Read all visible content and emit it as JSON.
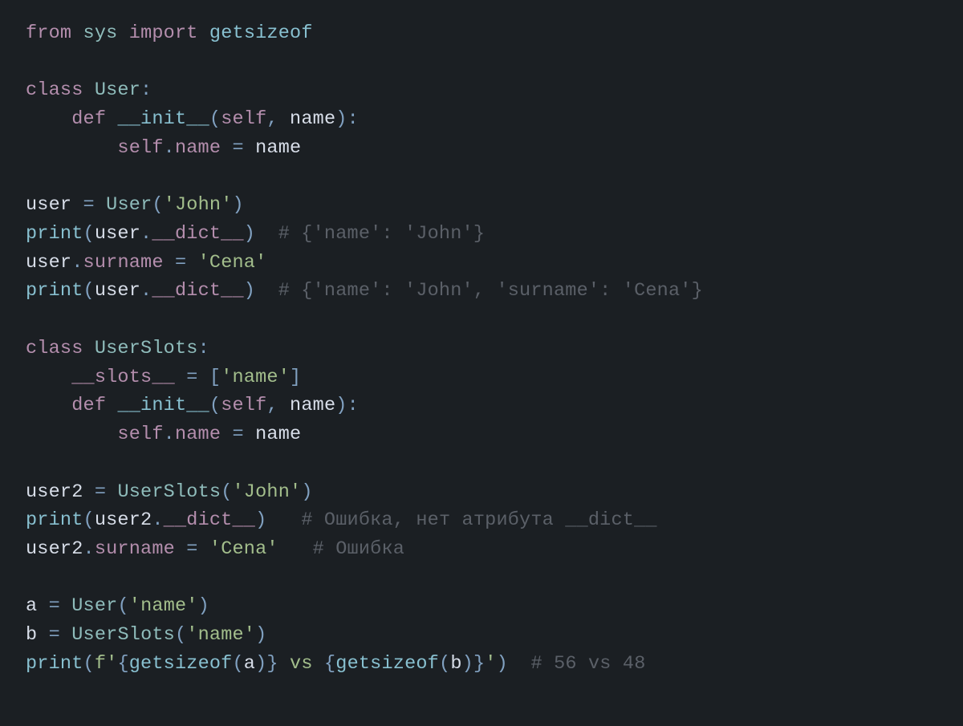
{
  "lines": [
    [
      {
        "cls": "kw",
        "t": "from"
      },
      {
        "cls": "",
        "t": " "
      },
      {
        "cls": "mod",
        "t": "sys"
      },
      {
        "cls": "",
        "t": " "
      },
      {
        "cls": "kw",
        "t": "import"
      },
      {
        "cls": "",
        "t": " "
      },
      {
        "cls": "fn",
        "t": "getsizeof"
      }
    ],
    [],
    [
      {
        "cls": "kw",
        "t": "class"
      },
      {
        "cls": "",
        "t": " "
      },
      {
        "cls": "cls",
        "t": "User"
      },
      {
        "cls": "op",
        "t": ":"
      }
    ],
    [
      {
        "cls": "",
        "t": "    "
      },
      {
        "cls": "kw",
        "t": "def"
      },
      {
        "cls": "",
        "t": " "
      },
      {
        "cls": "dunder",
        "t": "__init__"
      },
      {
        "cls": "op",
        "t": "("
      },
      {
        "cls": "slf",
        "t": "self"
      },
      {
        "cls": "op",
        "t": ","
      },
      {
        "cls": "",
        "t": " "
      },
      {
        "cls": "var",
        "t": "name"
      },
      {
        "cls": "op",
        "t": ")"
      },
      {
        "cls": "op",
        "t": ":"
      }
    ],
    [
      {
        "cls": "",
        "t": "        "
      },
      {
        "cls": "slf",
        "t": "self"
      },
      {
        "cls": "op",
        "t": "."
      },
      {
        "cls": "attr",
        "t": "name"
      },
      {
        "cls": "",
        "t": " "
      },
      {
        "cls": "op",
        "t": "="
      },
      {
        "cls": "",
        "t": " "
      },
      {
        "cls": "var",
        "t": "name"
      }
    ],
    [],
    [
      {
        "cls": "var",
        "t": "user"
      },
      {
        "cls": "",
        "t": " "
      },
      {
        "cls": "op",
        "t": "="
      },
      {
        "cls": "",
        "t": " "
      },
      {
        "cls": "cls",
        "t": "User"
      },
      {
        "cls": "op",
        "t": "("
      },
      {
        "cls": "str",
        "t": "'John'"
      },
      {
        "cls": "op",
        "t": ")"
      }
    ],
    [
      {
        "cls": "fn",
        "t": "print"
      },
      {
        "cls": "op",
        "t": "("
      },
      {
        "cls": "var",
        "t": "user"
      },
      {
        "cls": "op",
        "t": "."
      },
      {
        "cls": "dct",
        "t": "__dict__"
      },
      {
        "cls": "op",
        "t": ")"
      },
      {
        "cls": "",
        "t": "  "
      },
      {
        "cls": "cmt",
        "t": "# {'name': 'John'}"
      }
    ],
    [
      {
        "cls": "var",
        "t": "user"
      },
      {
        "cls": "op",
        "t": "."
      },
      {
        "cls": "attr",
        "t": "surname"
      },
      {
        "cls": "",
        "t": " "
      },
      {
        "cls": "op",
        "t": "="
      },
      {
        "cls": "",
        "t": " "
      },
      {
        "cls": "str",
        "t": "'Cena'"
      }
    ],
    [
      {
        "cls": "fn",
        "t": "print"
      },
      {
        "cls": "op",
        "t": "("
      },
      {
        "cls": "var",
        "t": "user"
      },
      {
        "cls": "op",
        "t": "."
      },
      {
        "cls": "dct",
        "t": "__dict__"
      },
      {
        "cls": "op",
        "t": ")"
      },
      {
        "cls": "",
        "t": "  "
      },
      {
        "cls": "cmt",
        "t": "# {'name': 'John', 'surname': 'Cena'}"
      }
    ],
    [],
    [
      {
        "cls": "kw",
        "t": "class"
      },
      {
        "cls": "",
        "t": " "
      },
      {
        "cls": "cls",
        "t": "UserSlots"
      },
      {
        "cls": "op",
        "t": ":"
      }
    ],
    [
      {
        "cls": "",
        "t": "    "
      },
      {
        "cls": "dct",
        "t": "__slots__"
      },
      {
        "cls": "",
        "t": " "
      },
      {
        "cls": "op",
        "t": "="
      },
      {
        "cls": "",
        "t": " "
      },
      {
        "cls": "op",
        "t": "["
      },
      {
        "cls": "str",
        "t": "'name'"
      },
      {
        "cls": "op",
        "t": "]"
      }
    ],
    [
      {
        "cls": "",
        "t": "    "
      },
      {
        "cls": "kw",
        "t": "def"
      },
      {
        "cls": "",
        "t": " "
      },
      {
        "cls": "dunder",
        "t": "__init__"
      },
      {
        "cls": "op",
        "t": "("
      },
      {
        "cls": "slf",
        "t": "self"
      },
      {
        "cls": "op",
        "t": ","
      },
      {
        "cls": "",
        "t": " "
      },
      {
        "cls": "var",
        "t": "name"
      },
      {
        "cls": "op",
        "t": ")"
      },
      {
        "cls": "op",
        "t": ":"
      }
    ],
    [
      {
        "cls": "",
        "t": "        "
      },
      {
        "cls": "slf",
        "t": "self"
      },
      {
        "cls": "op",
        "t": "."
      },
      {
        "cls": "attr",
        "t": "name"
      },
      {
        "cls": "",
        "t": " "
      },
      {
        "cls": "op",
        "t": "="
      },
      {
        "cls": "",
        "t": " "
      },
      {
        "cls": "var",
        "t": "name"
      }
    ],
    [],
    [
      {
        "cls": "var",
        "t": "user2"
      },
      {
        "cls": "",
        "t": " "
      },
      {
        "cls": "op",
        "t": "="
      },
      {
        "cls": "",
        "t": " "
      },
      {
        "cls": "cls",
        "t": "UserSlots"
      },
      {
        "cls": "op",
        "t": "("
      },
      {
        "cls": "str",
        "t": "'John'"
      },
      {
        "cls": "op",
        "t": ")"
      }
    ],
    [
      {
        "cls": "fn",
        "t": "print"
      },
      {
        "cls": "op",
        "t": "("
      },
      {
        "cls": "var",
        "t": "user2"
      },
      {
        "cls": "op",
        "t": "."
      },
      {
        "cls": "dct",
        "t": "__dict__"
      },
      {
        "cls": "op",
        "t": ")"
      },
      {
        "cls": "",
        "t": "   "
      },
      {
        "cls": "cmt",
        "t": "# Ошибка, нет атрибута __dict__"
      }
    ],
    [
      {
        "cls": "var",
        "t": "user2"
      },
      {
        "cls": "op",
        "t": "."
      },
      {
        "cls": "attr",
        "t": "surname"
      },
      {
        "cls": "",
        "t": " "
      },
      {
        "cls": "op",
        "t": "="
      },
      {
        "cls": "",
        "t": " "
      },
      {
        "cls": "str",
        "t": "'Cena'"
      },
      {
        "cls": "",
        "t": "   "
      },
      {
        "cls": "cmt",
        "t": "# Ошибка"
      }
    ],
    [],
    [
      {
        "cls": "var",
        "t": "a"
      },
      {
        "cls": "",
        "t": " "
      },
      {
        "cls": "op",
        "t": "="
      },
      {
        "cls": "",
        "t": " "
      },
      {
        "cls": "cls",
        "t": "User"
      },
      {
        "cls": "op",
        "t": "("
      },
      {
        "cls": "str",
        "t": "'name'"
      },
      {
        "cls": "op",
        "t": ")"
      }
    ],
    [
      {
        "cls": "var",
        "t": "b"
      },
      {
        "cls": "",
        "t": " "
      },
      {
        "cls": "op",
        "t": "="
      },
      {
        "cls": "",
        "t": " "
      },
      {
        "cls": "cls",
        "t": "UserSlots"
      },
      {
        "cls": "op",
        "t": "("
      },
      {
        "cls": "str",
        "t": "'name'"
      },
      {
        "cls": "op",
        "t": ")"
      }
    ],
    [
      {
        "cls": "fn",
        "t": "print"
      },
      {
        "cls": "op",
        "t": "("
      },
      {
        "cls": "str",
        "t": "f'"
      },
      {
        "cls": "op",
        "t": "{"
      },
      {
        "cls": "fn",
        "t": "getsizeof"
      },
      {
        "cls": "op",
        "t": "("
      },
      {
        "cls": "var",
        "t": "a"
      },
      {
        "cls": "op",
        "t": ")"
      },
      {
        "cls": "op",
        "t": "}"
      },
      {
        "cls": "str",
        "t": " vs "
      },
      {
        "cls": "op",
        "t": "{"
      },
      {
        "cls": "fn",
        "t": "getsizeof"
      },
      {
        "cls": "op",
        "t": "("
      },
      {
        "cls": "var",
        "t": "b"
      },
      {
        "cls": "op",
        "t": ")"
      },
      {
        "cls": "op",
        "t": "}"
      },
      {
        "cls": "str",
        "t": "'"
      },
      {
        "cls": "op",
        "t": ")"
      },
      {
        "cls": "",
        "t": "  "
      },
      {
        "cls": "cmt",
        "t": "# 56 vs 48"
      }
    ]
  ]
}
